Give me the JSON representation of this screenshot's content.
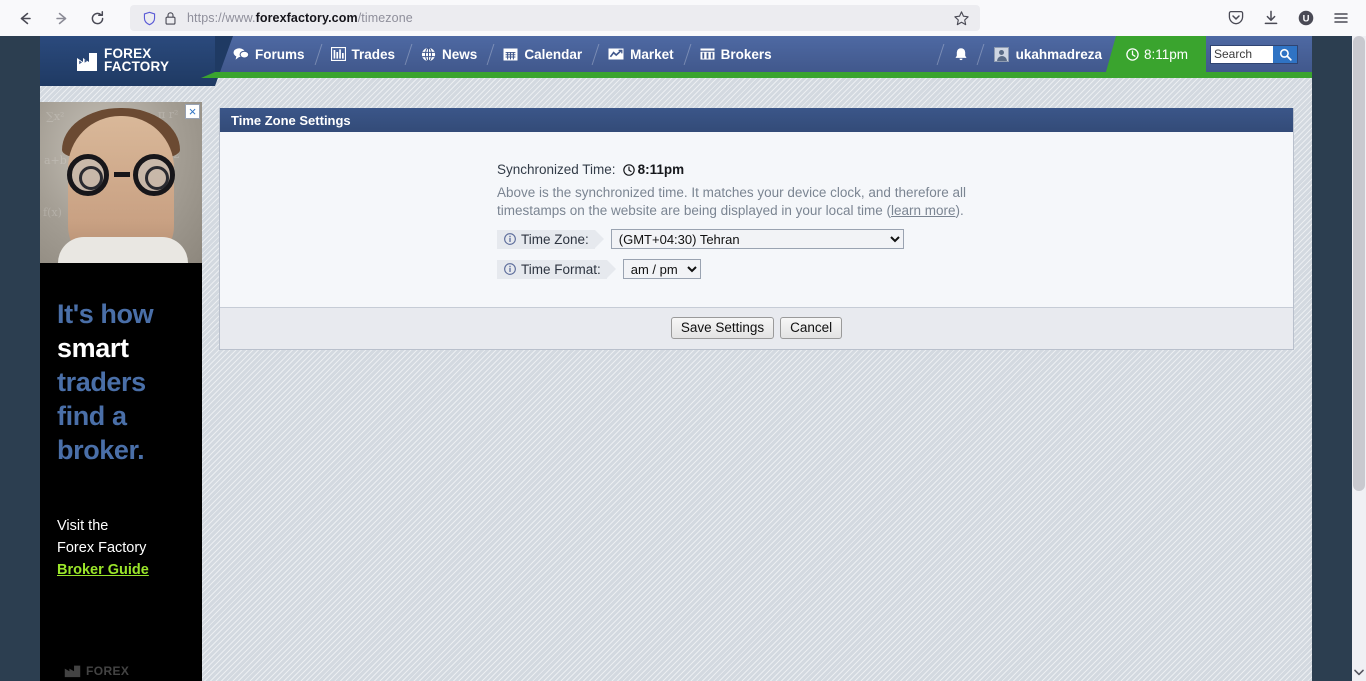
{
  "browser": {
    "back_label": "Back",
    "forward_label": "Forward",
    "reload_label": "Reload",
    "url_protocol": "https://www.",
    "url_host": "forexfactory.com",
    "url_path": "/timezone",
    "bookmark_label": "Bookmark this page",
    "pocket_label": "Save to Pocket",
    "downloads_label": "Downloads",
    "account_label": "U",
    "menu_label": "Open application menu"
  },
  "site": {
    "logo_line1": "FOREX",
    "logo_line2": "FACTORY",
    "nav": [
      {
        "label": "Forums",
        "icon": "speech-bubbles-icon"
      },
      {
        "label": "Trades",
        "icon": "bar-chart-icon"
      },
      {
        "label": "News",
        "icon": "globe-icon"
      },
      {
        "label": "Calendar",
        "icon": "calendar-icon"
      },
      {
        "label": "Market",
        "icon": "chart-line-icon"
      },
      {
        "label": "Brokers",
        "icon": "building-icon"
      }
    ],
    "notifications_label": "Notifications",
    "username": "ukahmadreza",
    "clock_time": "8:11pm",
    "search_placeholder": "Search",
    "search_value": "",
    "search_button_label": "Search"
  },
  "ad": {
    "close_label": "×",
    "headline_line1": "It's how",
    "headline_line2": "smart",
    "headline_line3": "traders",
    "headline_line4": "find a",
    "headline_line5": "broker.",
    "cta_line1": "Visit the",
    "cta_line2": "Forex Factory",
    "cta_link": "Broker Guide",
    "footer_brand": "FOREX",
    "accent_color": "#9ae52a",
    "headline_blue": "#4a6fa8"
  },
  "panel": {
    "title": "Time Zone Settings",
    "sync_label": "Synchronized Time:",
    "sync_time": "8:11pm",
    "description_part1": "Above is the synchronized time. It matches your device clock, and therefore all timestamps on the website are being displayed in your local time (",
    "description_link": "learn more",
    "description_part2": ").",
    "timezone_label": "Time Zone:",
    "timezone_value": "(GMT+04:30) Tehran",
    "timezone_options": [
      "(GMT+04:30) Tehran"
    ],
    "timeformat_label": "Time Format:",
    "timeformat_value": "am / pm",
    "timeformat_options": [
      "am / pm"
    ],
    "save_label": "Save Settings",
    "cancel_label": "Cancel"
  }
}
